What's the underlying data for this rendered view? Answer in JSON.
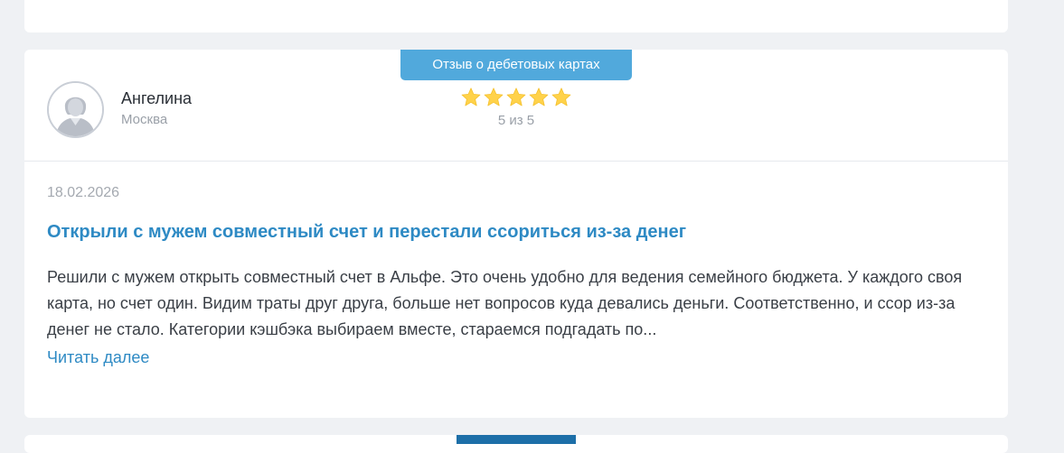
{
  "review": {
    "category": "Отзыв о дебетовых картах",
    "author": {
      "name": "Ангелина",
      "city": "Москва"
    },
    "rating": {
      "value": 5,
      "max": 5,
      "text": "5 из 5"
    },
    "date": "18.02.2026",
    "title": "Открыли с мужем совместный счет и перестали ссориться из-за денег",
    "text": "Решили с мужем открыть совместный счет в Альфе. Это очень удобно для ведения семейного бюджета. У каждого своя карта, но счет один. Видим траты друг друга, больше нет вопросов куда девались деньги. Соответственно, и ссор из-за денег не стало. Категории кэшбэка выбираем вместе, стараемся подгадать по...",
    "read_more": "Читать далее"
  },
  "colors": {
    "accent": "#2e8ac4",
    "badge": "#51a9dc",
    "star": "#ffd24a",
    "background": "#eff1f4"
  },
  "icons": {
    "avatar": "user-silhouette-icon",
    "star": "star-icon"
  }
}
